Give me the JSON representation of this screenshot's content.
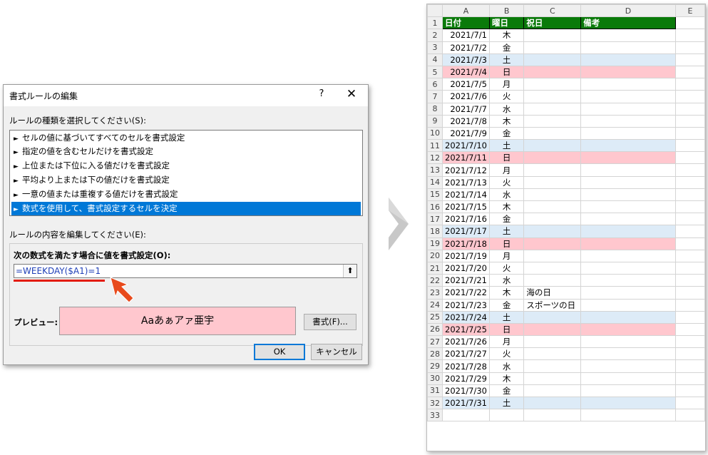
{
  "dialog": {
    "title": "書式ルールの編集",
    "help": "?",
    "close": "✕",
    "rule_type_label": "ルールの種類を選択してください(S):",
    "rule_types": [
      "セルの値に基づいてすべてのセルを書式設定",
      "指定の値を含むセルだけを書式設定",
      "上位または下位に入る値だけを書式設定",
      "平均より上または下の値だけを書式設定",
      "一意の値または重複する値だけを書式設定",
      "数式を使用して、書式設定するセルを決定"
    ],
    "selected_rule_index": 5,
    "edit_label": "ルールの内容を編集してください(E):",
    "formula_label": "次の数式を満たす場合に値を書式設定(O):",
    "formula_value": "=WEEKDAY($A1)=1",
    "preview_label": "プレビュー:",
    "preview_text": "Aaあぁアァ亜宇",
    "format_button": "書式(F)...",
    "ok_button": "OK",
    "cancel_button": "キャンセル",
    "preview_fill_color": "#ffc7ce",
    "annotation_color": "#e31b0d"
  },
  "sheet": {
    "columns": [
      "A",
      "B",
      "C",
      "D",
      "E"
    ],
    "header": [
      "日付",
      "曜日",
      "祝日",
      "備考"
    ],
    "header_color": "#0a7a0a",
    "saturday_color": "#ddebf7",
    "sunday_color": "#ffc7ce",
    "rows": [
      {
        "n": "2",
        "date": "2021/7/1",
        "wd": "木",
        "holiday": "",
        "type": ""
      },
      {
        "n": "3",
        "date": "2021/7/2",
        "wd": "金",
        "holiday": "",
        "type": ""
      },
      {
        "n": "4",
        "date": "2021/7/3",
        "wd": "土",
        "holiday": "",
        "type": "sat"
      },
      {
        "n": "5",
        "date": "2021/7/4",
        "wd": "日",
        "holiday": "",
        "type": "sun"
      },
      {
        "n": "6",
        "date": "2021/7/5",
        "wd": "月",
        "holiday": "",
        "type": ""
      },
      {
        "n": "7",
        "date": "2021/7/6",
        "wd": "火",
        "holiday": "",
        "type": ""
      },
      {
        "n": "8",
        "date": "2021/7/7",
        "wd": "水",
        "holiday": "",
        "type": ""
      },
      {
        "n": "9",
        "date": "2021/7/8",
        "wd": "木",
        "holiday": "",
        "type": ""
      },
      {
        "n": "10",
        "date": "2021/7/9",
        "wd": "金",
        "holiday": "",
        "type": ""
      },
      {
        "n": "11",
        "date": "2021/7/10",
        "wd": "土",
        "holiday": "",
        "type": "sat"
      },
      {
        "n": "12",
        "date": "2021/7/11",
        "wd": "日",
        "holiday": "",
        "type": "sun"
      },
      {
        "n": "13",
        "date": "2021/7/12",
        "wd": "月",
        "holiday": "",
        "type": ""
      },
      {
        "n": "14",
        "date": "2021/7/13",
        "wd": "火",
        "holiday": "",
        "type": ""
      },
      {
        "n": "15",
        "date": "2021/7/14",
        "wd": "水",
        "holiday": "",
        "type": ""
      },
      {
        "n": "16",
        "date": "2021/7/15",
        "wd": "木",
        "holiday": "",
        "type": ""
      },
      {
        "n": "17",
        "date": "2021/7/16",
        "wd": "金",
        "holiday": "",
        "type": ""
      },
      {
        "n": "18",
        "date": "2021/7/17",
        "wd": "土",
        "holiday": "",
        "type": "sat"
      },
      {
        "n": "19",
        "date": "2021/7/18",
        "wd": "日",
        "holiday": "",
        "type": "sun"
      },
      {
        "n": "20",
        "date": "2021/7/19",
        "wd": "月",
        "holiday": "",
        "type": ""
      },
      {
        "n": "21",
        "date": "2021/7/20",
        "wd": "火",
        "holiday": "",
        "type": ""
      },
      {
        "n": "22",
        "date": "2021/7/21",
        "wd": "水",
        "holiday": "",
        "type": ""
      },
      {
        "n": "23",
        "date": "2021/7/22",
        "wd": "木",
        "holiday": "海の日",
        "type": ""
      },
      {
        "n": "24",
        "date": "2021/7/23",
        "wd": "金",
        "holiday": "スポーツの日",
        "type": ""
      },
      {
        "n": "25",
        "date": "2021/7/24",
        "wd": "土",
        "holiday": "",
        "type": "sat"
      },
      {
        "n": "26",
        "date": "2021/7/25",
        "wd": "日",
        "holiday": "",
        "type": "sun"
      },
      {
        "n": "27",
        "date": "2021/7/26",
        "wd": "月",
        "holiday": "",
        "type": ""
      },
      {
        "n": "28",
        "date": "2021/7/27",
        "wd": "火",
        "holiday": "",
        "type": ""
      },
      {
        "n": "29",
        "date": "2021/7/28",
        "wd": "水",
        "holiday": "",
        "type": ""
      },
      {
        "n": "30",
        "date": "2021/7/29",
        "wd": "木",
        "holiday": "",
        "type": ""
      },
      {
        "n": "31",
        "date": "2021/7/30",
        "wd": "金",
        "holiday": "",
        "type": ""
      },
      {
        "n": "32",
        "date": "2021/7/31",
        "wd": "土",
        "holiday": "",
        "type": "sat"
      }
    ],
    "last_row_number": "33"
  }
}
